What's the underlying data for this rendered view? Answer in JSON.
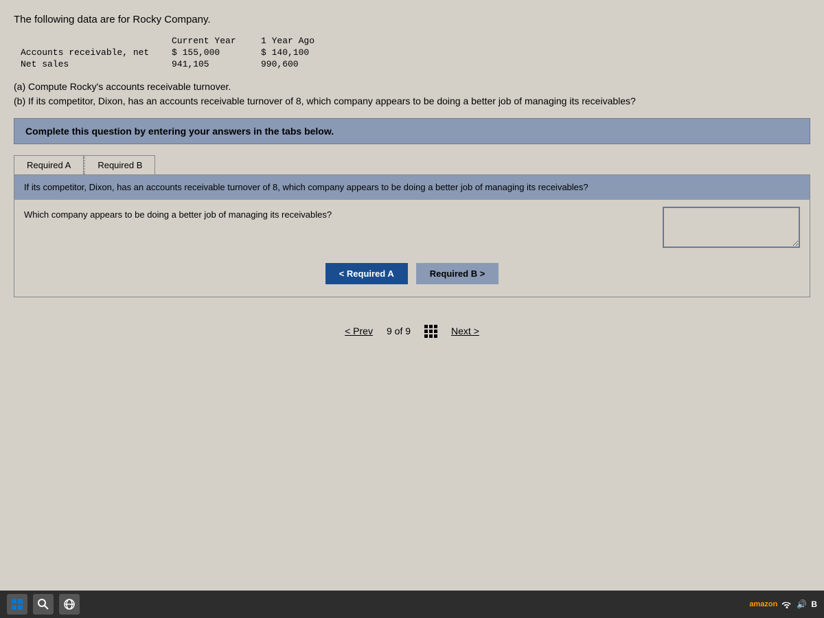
{
  "page": {
    "intro": "The following data are for Rocky Company.",
    "data_table": {
      "headers": {
        "current_year": "Current Year",
        "one_year_ago": "1 Year Ago"
      },
      "rows": [
        {
          "label": "Accounts receivable, net",
          "current": "$ 155,000",
          "prior": "$ 140,100"
        },
        {
          "label": "Net sales",
          "current": "941,105",
          "prior": "990,600"
        }
      ]
    },
    "questions": {
      "a": "(a) Compute Rocky's accounts receivable turnover.",
      "b": "(b) If its competitor, Dixon, has an accounts receivable turnover of 8, which company appears to be doing a better job of managing its receivables?"
    },
    "complete_banner": "Complete this question by entering your answers in the tabs below.",
    "tabs": [
      {
        "id": "required-a",
        "label": "Required A"
      },
      {
        "id": "required-b",
        "label": "Required B"
      }
    ],
    "active_tab": "required-b",
    "tab_content": {
      "required_b": {
        "header_text": "If its competitor, Dixon, has an accounts receivable turnover of 8, which company appears to be doing a better job of managing its receivables?",
        "question_label": "Which company appears to be doing a better job of managing its receivables?"
      }
    },
    "nav_buttons": {
      "prev_required_a": "< Required A",
      "next_required_b": "Required B >",
      "required_a_label": "Required A",
      "required_b_label": "Required B"
    },
    "bottom_nav": {
      "prev_label": "< Prev",
      "page_current": "9",
      "page_total": "9",
      "page_of": "of",
      "next_label": "Next >"
    }
  }
}
